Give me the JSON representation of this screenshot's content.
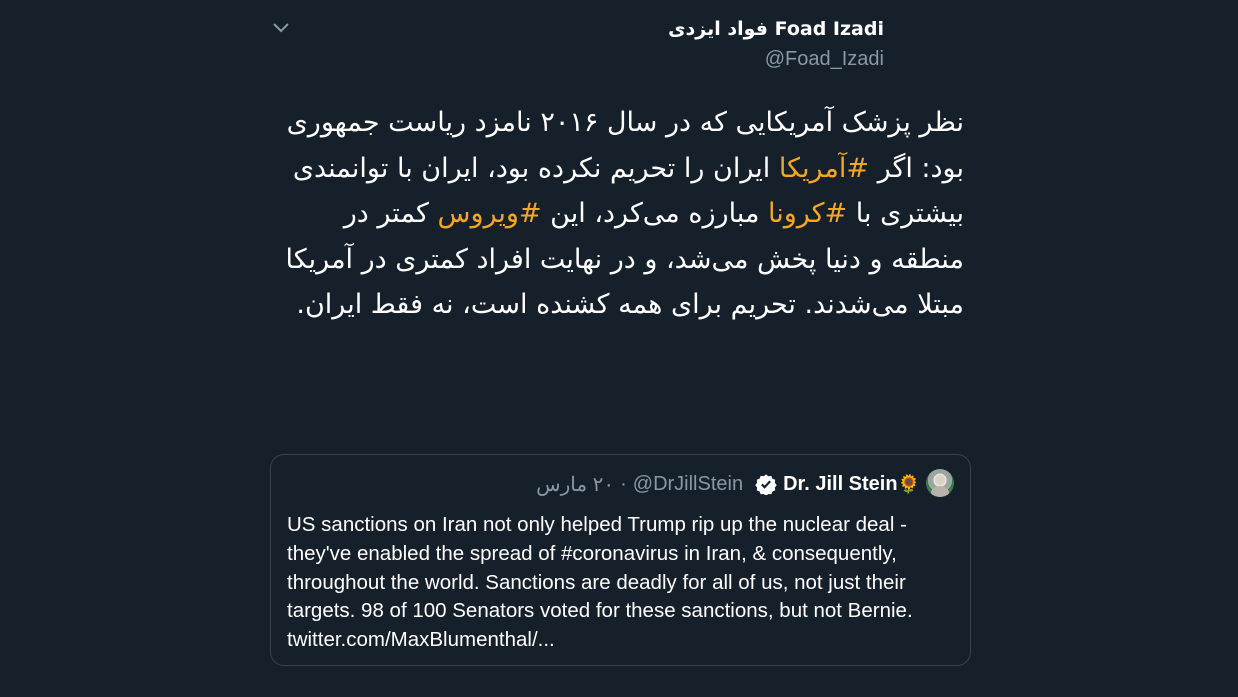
{
  "tweet": {
    "author_name": "فواد ایزدی Foad Izadi",
    "author_handle": "@Foad_Izadi",
    "text_segments": [
      {
        "text": "نظر پزشک آمریکایی که در سال ۲۰۱۶ نامزد ریاست جمهوری بود: اگر ",
        "hashtag": false
      },
      {
        "text": "#آمریکا",
        "hashtag": true
      },
      {
        "text": " ایران را تحریم نکرده بود، ایران با توانمندی بیشتری با ",
        "hashtag": false
      },
      {
        "text": "#کرونا",
        "hashtag": true
      },
      {
        "text": " مبارزه می‌کرد، این ",
        "hashtag": false
      },
      {
        "text": "#ویروس",
        "hashtag": true
      },
      {
        "text": " کمتر در منطقه و دنیا پخش می‌شد، و در نهایت افراد کمتری در آمریکا مبتلا می‌شدند. تحریم برای همه کشنده است، نه فقط ایران.",
        "hashtag": false
      }
    ]
  },
  "quote": {
    "author_name": "Dr. Jill Stein",
    "name_emoji": "🌻",
    "handle": "@DrJillStein",
    "separator": "·",
    "date": "۲۰ مارس",
    "text": "US sanctions on Iran not only helped Trump rip up the nuclear deal - they've enabled the spread of #coronavirus in Iran, & consequently, throughout the world. Sanctions are deadly for all of us, not just their targets. 98 of 100 Senators voted for these sanctions, but not Bernie. twitter.com/MaxBlumenthal/..."
  },
  "colors": {
    "background": "#15202b",
    "hashtag": "#f5a623",
    "secondary_text": "#8899a6",
    "border": "#38444d"
  },
  "icons": {
    "menu": "chevron-down-icon",
    "verified": "verified-badge-icon",
    "avatar": "avatar-image"
  }
}
